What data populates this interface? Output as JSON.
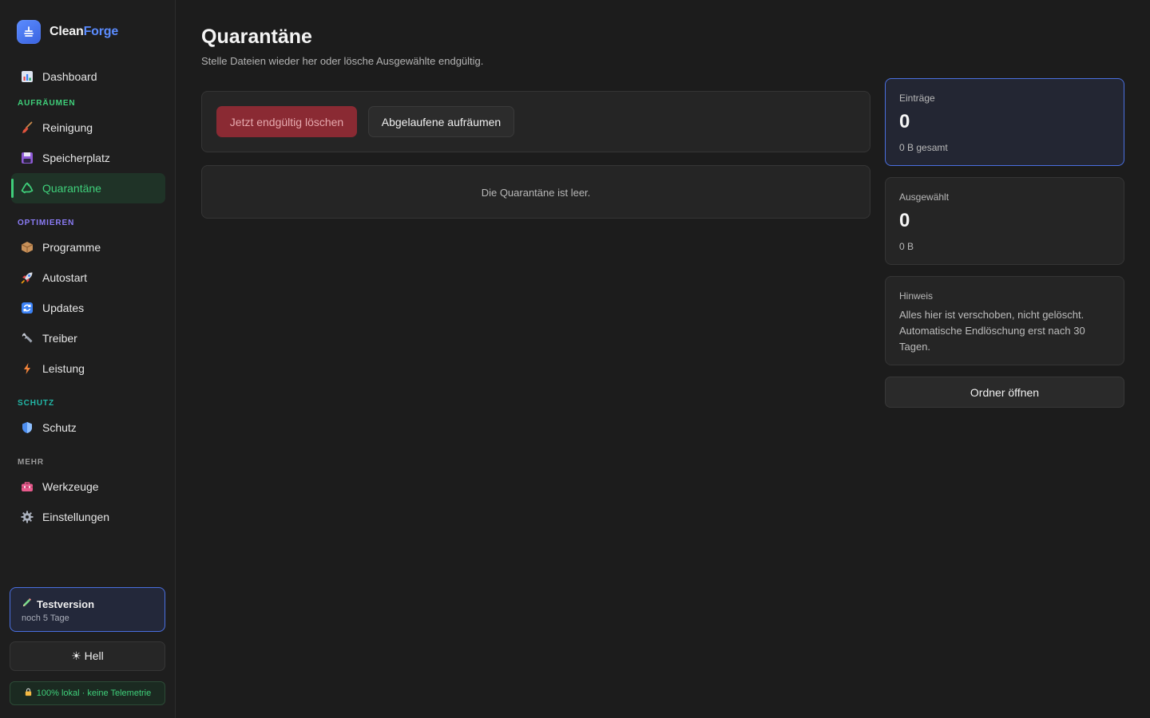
{
  "brand": {
    "part1": "Clean",
    "part2": "Forge"
  },
  "sidebar": {
    "items": [
      {
        "label": "Dashboard",
        "icon": "chart-icon"
      },
      {
        "section": "AUFRÄUMEN",
        "color": "#3fcf7a"
      },
      {
        "label": "Reinigung",
        "icon": "broom-icon"
      },
      {
        "label": "Speicherplatz",
        "icon": "floppy-disk-icon"
      },
      {
        "label": "Quarantäne",
        "icon": "recycle-icon",
        "active": true
      },
      {
        "section": "OPTIMIEREN",
        "color": "#8b7cf6"
      },
      {
        "label": "Programme",
        "icon": "package-icon"
      },
      {
        "label": "Autostart",
        "icon": "rocket-icon"
      },
      {
        "label": "Updates",
        "icon": "refresh-icon"
      },
      {
        "label": "Treiber",
        "icon": "wrench-icon"
      },
      {
        "label": "Leistung",
        "icon": "lightning-icon"
      },
      {
        "section": "SCHUTZ",
        "color": "#22b8a8"
      },
      {
        "label": "Schutz",
        "icon": "shield-icon"
      },
      {
        "section": "MEHR",
        "color": "#9a9a9a"
      },
      {
        "label": "Werkzeuge",
        "icon": "toolbox-icon"
      },
      {
        "label": "Einstellungen",
        "icon": "gear-icon"
      }
    ],
    "trial": {
      "title": "Testversion",
      "sub": "noch 5 Tage"
    },
    "theme_toggle": "☀ Hell",
    "local_badge": "100% lokal · keine Telemetrie"
  },
  "main": {
    "title": "Quarantäne",
    "subtitle": "Stelle Dateien wieder her oder lösche Ausgewählte endgültig.",
    "delete_button": "Jetzt endgültig löschen",
    "cleanup_button": "Abgelaufene aufräumen",
    "empty_message": "Die Quarantäne ist leer."
  },
  "panel": {
    "entries": {
      "label": "Einträge",
      "value": "0",
      "sub": "0 B gesamt"
    },
    "selected": {
      "label": "Ausgewählt",
      "value": "0",
      "sub": "0 B"
    },
    "note": {
      "label": "Hinweis",
      "text": "Alles hier ist verschoben, nicht gelöscht. Automatische Endlöschung erst nach 30 Tagen."
    },
    "open_folder_button": "Ordner öffnen"
  },
  "colors": {
    "accent_green": "#3fcf7a",
    "accent_blue": "#5b8cff",
    "danger": "#8a2a33"
  }
}
